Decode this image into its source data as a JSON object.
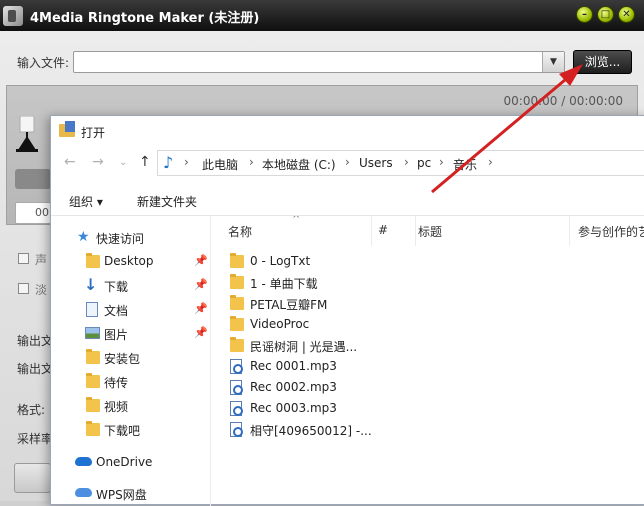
{
  "app": {
    "title": "4Media Ringtone Maker (未注册)",
    "input_label": "输入文件:",
    "input_value": "",
    "browse_label": "浏览...",
    "time_readout": "00:00:00 / 00:00:00",
    "side_field": "00",
    "checkbox_labels": [
      "声",
      "淡"
    ],
    "side_texts": [
      "输出文",
      "输出文",
      "格式:",
      "采样率"
    ],
    "window_buttons": {
      "minimize": "–",
      "maximize": "□",
      "close": "✕"
    }
  },
  "dialog": {
    "title": "打开",
    "breadcrumb": [
      "此电脑",
      "本地磁盘 (C:)",
      "Users",
      "pc",
      "音乐"
    ],
    "organize_label": "组织 ▾",
    "new_folder_label": "新建文件夹",
    "nav_items": [
      {
        "label": "快速访问",
        "icon": "star-icon",
        "pinned": false
      },
      {
        "label": "Desktop",
        "icon": "folder-icon",
        "pinned": true
      },
      {
        "label": "下载",
        "icon": "download-icon",
        "pinned": true
      },
      {
        "label": "文档",
        "icon": "document-icon",
        "pinned": true
      },
      {
        "label": "图片",
        "icon": "picture-icon",
        "pinned": true
      },
      {
        "label": "安装包",
        "icon": "folder-icon",
        "pinned": false
      },
      {
        "label": "待传",
        "icon": "folder-icon",
        "pinned": false
      },
      {
        "label": "视频",
        "icon": "folder-icon",
        "pinned": false
      },
      {
        "label": "下载吧",
        "icon": "folder-icon",
        "pinned": false
      },
      {
        "label": "OneDrive",
        "icon": "cloud-icon",
        "pinned": false
      },
      {
        "label": "WPS网盘",
        "icon": "cloud-icon",
        "pinned": false
      }
    ],
    "columns": [
      "名称",
      "#",
      "标题",
      "参与创作的艺"
    ],
    "files": [
      {
        "name": "0 - LogTxt",
        "type": "folder"
      },
      {
        "name": "1 - 单曲下载",
        "type": "folder"
      },
      {
        "name": "PETAL豆瓣FM",
        "type": "folder"
      },
      {
        "name": "VideoProc",
        "type": "folder"
      },
      {
        "name": "民谣树洞 | 光是遇...",
        "type": "folder"
      },
      {
        "name": "Rec 0001.mp3",
        "type": "mp3"
      },
      {
        "name": "Rec 0002.mp3",
        "type": "mp3"
      },
      {
        "name": "Rec 0003.mp3",
        "type": "mp3"
      },
      {
        "name": "相守[409650012] -...",
        "type": "mp3"
      }
    ]
  },
  "colors": {
    "annotation_arrow": "#d42020",
    "app_titlebar": "#1a1a1a",
    "window_button": "#b5d400",
    "folder": "#f3c34c",
    "accent": "#1a73c8"
  }
}
